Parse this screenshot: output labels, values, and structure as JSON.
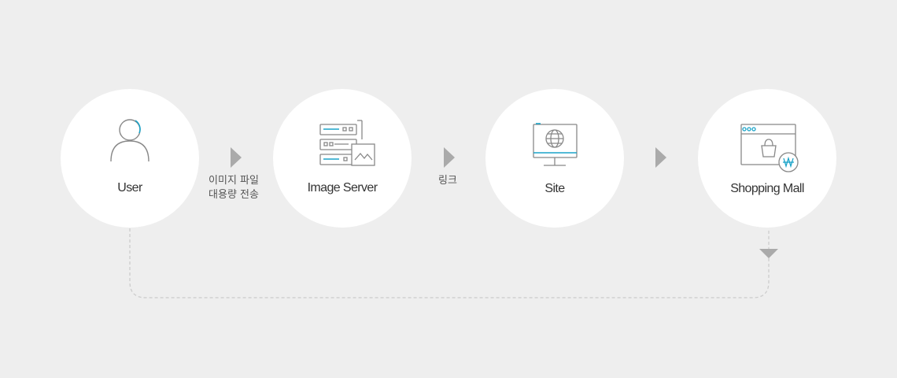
{
  "nodes": [
    {
      "label": "User",
      "icon": "user-icon"
    },
    {
      "label": "Image Server",
      "icon": "server-icon"
    },
    {
      "label": "Site",
      "icon": "monitor-globe-icon"
    },
    {
      "label": "Shopping Mall",
      "icon": "shopping-bag-icon"
    }
  ],
  "steps": [
    {
      "lines": [
        "이미지 파일",
        "대용량 전송"
      ]
    },
    {
      "lines": [
        "링크"
      ]
    },
    {
      "lines": []
    }
  ],
  "colors": {
    "background": "#eeeeee",
    "circle": "#ffffff",
    "accent": "#1aa3c8",
    "arrow": "#aaaaaa",
    "icon_stroke": "#888888",
    "dashed_line": "#cccccc"
  }
}
